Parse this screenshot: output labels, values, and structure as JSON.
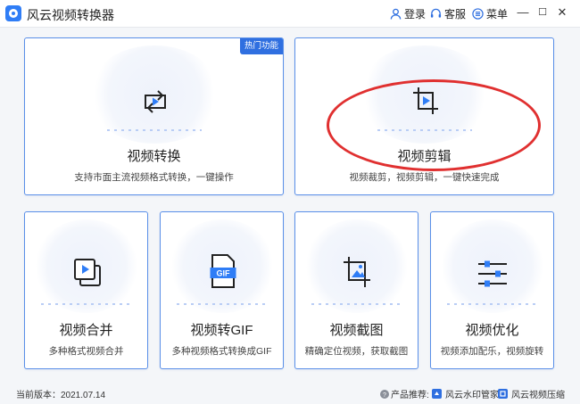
{
  "titlebar": {
    "app_title": "风云视频转换器",
    "login_label": "登录",
    "service_label": "客服",
    "menu_label": "菜单",
    "minimize_glyph": "—",
    "maximize_glyph": "☐",
    "close_glyph": "✕"
  },
  "cards": {
    "convert": {
      "title": "视频转换",
      "desc": "支持市面主流视频格式转换，一键操作",
      "badge": "热门功能"
    },
    "crop": {
      "title": "视频剪辑",
      "desc": "视频裁剪，视频剪辑，一键快速完成"
    },
    "merge": {
      "title": "视频合并",
      "desc": "多种格式视频合并"
    },
    "gif": {
      "title": "视频转GIF",
      "desc": "多种视频格式转换成GIF",
      "icon_text": "GIF"
    },
    "screenshot": {
      "title": "视频截图",
      "desc": "精确定位视频，获取截图"
    },
    "optimize": {
      "title": "视频优化",
      "desc": "视频添加配乐，视频旋转"
    }
  },
  "footer": {
    "version": "当前版本：2021.07.14",
    "recommend_label": "产品推荐:",
    "product1": "风云水印管家",
    "product2": "风云视频压缩"
  },
  "colors": {
    "accent": "#2f6fe0",
    "card_border": "#5a8fe8",
    "annotation": "#e03030"
  }
}
